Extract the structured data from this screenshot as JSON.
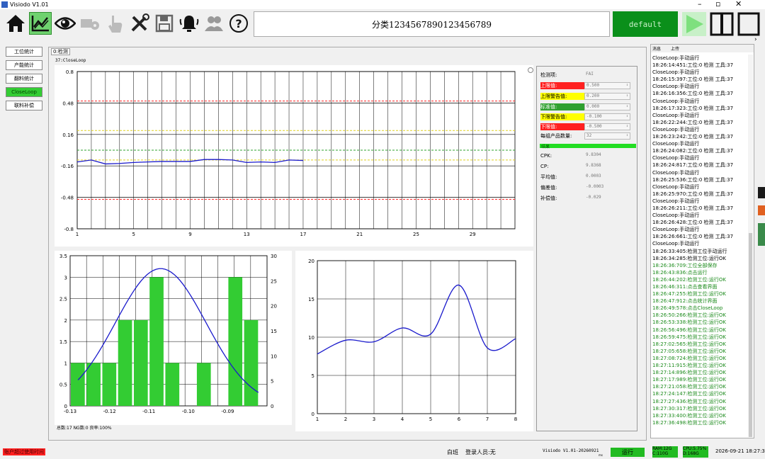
{
  "window": {
    "title": "Visiodo V1.01",
    "min": "–",
    "restore": "▫",
    "close": "✕"
  },
  "toolbar": {
    "category_text": "分类1234567890123456789",
    "default_label": "default",
    "icons": [
      "home-icon",
      "chart-icon",
      "eye-icon",
      "camera-settings-icon",
      "hand-icon",
      "tools-icon",
      "save-icon",
      "alarm-icon",
      "users-icon",
      "help-icon"
    ]
  },
  "nav": [
    "工位统计",
    "产能统计",
    "翻料统计",
    "CloseLoop",
    "联料补偿"
  ],
  "subtab": "0:检测",
  "chart_name": "37:CloseLoop",
  "chart_data": [
    {
      "type": "line",
      "xlim": [
        1,
        32
      ],
      "ylim": [
        -0.8,
        0.8
      ],
      "xticks": [
        1,
        5,
        9,
        13,
        17,
        21,
        25,
        29
      ],
      "yticks": [
        "0.8",
        "0.48",
        "0.16",
        "-0.16",
        "-0.48",
        "-0.8"
      ],
      "ytick_values": [
        0.8,
        0.48,
        0.16,
        -0.16,
        -0.48,
        -0.8
      ],
      "x": [
        1,
        2,
        3,
        4,
        5,
        6,
        7,
        8,
        9,
        10,
        11,
        12,
        13,
        14,
        15,
        16,
        17
      ],
      "values": [
        -0.12,
        -0.1,
        -0.14,
        -0.135,
        -0.125,
        -0.12,
        -0.115,
        -0.115,
        -0.115,
        -0.095,
        -0.095,
        -0.1,
        -0.125,
        -0.12,
        -0.125,
        -0.1,
        -0.105
      ],
      "ref_lines": [
        {
          "y": 0.5,
          "color": "#ff2020"
        },
        {
          "y": 0.2,
          "color": "#e0d020"
        },
        {
          "y": 0,
          "color": "#2fa02f"
        },
        {
          "y": -0.1,
          "color": "#e0d020"
        },
        {
          "y": -0.5,
          "color": "#ff2020"
        }
      ]
    },
    {
      "type": "bar",
      "xlim": [
        -0.13,
        -0.08
      ],
      "ylim": [
        0,
        3.5
      ],
      "y2lim": [
        0,
        30
      ],
      "xticks": [
        "-0.13",
        "-0.12",
        "-0.11",
        "-0.10",
        "-0.09"
      ],
      "xtick_values": [
        -0.13,
        -0.12,
        -0.11,
        -0.1,
        -0.09
      ],
      "yticks": [
        "0",
        "0.5",
        "1",
        "1.5",
        "2",
        "2.5",
        "3",
        "3.5"
      ],
      "y2ticks": [
        "0",
        "5",
        "10",
        "15",
        "20",
        "25",
        "30"
      ],
      "bar_x": [
        -0.13,
        -0.126,
        -0.122,
        -0.118,
        -0.114,
        -0.11,
        -0.106,
        -0.098,
        -0.09,
        -0.086
      ],
      "values": [
        1,
        1,
        1,
        2,
        2,
        3,
        1,
        1,
        3,
        2
      ],
      "curve_peak": -0.107,
      "curve_sigma": 0.0115,
      "curve_max": 3.2
    },
    {
      "type": "line",
      "xlim": [
        1,
        8
      ],
      "ylim": [
        0,
        20
      ],
      "xticks": [
        "1",
        "2",
        "3",
        "4",
        "5",
        "6",
        "7",
        "8"
      ],
      "yticks": [
        "0",
        "5",
        "10",
        "15",
        "20"
      ],
      "x": [
        1,
        2,
        3,
        4,
        5,
        6,
        7,
        8
      ],
      "values": [
        7.8,
        9.6,
        9.4,
        11.2,
        10.4,
        16.8,
        8.6,
        9.8
      ]
    }
  ],
  "hist_summary": "总数:17  NG数:0  良率:100%",
  "side": {
    "item_label": "检测项:",
    "item_value": "FAI",
    "rows": [
      {
        "label": "上限值:",
        "value": "0.500",
        "style": "red"
      },
      {
        "label": "上限警告值:",
        "value": "0.200",
        "style": "yel"
      },
      {
        "label": "标准值:",
        "value": "0.000",
        "style": "grn"
      },
      {
        "label": "下限警告值:",
        "value": "-0.100",
        "style": "yel"
      },
      {
        "label": "下限值:",
        "value": "-0.500",
        "style": "red"
      },
      {
        "label": "每组产品数量:",
        "value": "32",
        "style": ""
      }
    ],
    "result_label": "结果",
    "results": [
      {
        "label": "CPK:",
        "value": "9.8304"
      },
      {
        "label": "CP:",
        "value": "9.8368"
      },
      {
        "label": "平均值:",
        "value": "0.0003"
      },
      {
        "label": "偏差值:",
        "value": "-0.0003"
      },
      {
        "label": "补偿值:",
        "value": "-0.029"
      }
    ]
  },
  "right": {
    "tab1": "消息",
    "tab2": "上传",
    "log": [
      "CloseLoop:手动运行",
      "18:26:14:451:工位:0 检测 工具:37",
      "CloseLoop:手动运行",
      "18:26:15:397:工位:0 检测 工具:37",
      "CloseLoop:手动运行",
      "18:26:16:356:工位:0 检测 工具:37",
      "CloseLoop:手动运行",
      "18:26:17:323:工位:0 检测 工具:37",
      "CloseLoop:手动运行",
      "18:26:22:244:工位:0 检测 工具:37",
      "CloseLoop:手动运行",
      "18:26:23:242:工位:0 检测 工具:37",
      "CloseLoop:手动运行",
      "18:26:24:082:工位:0 检测 工具:37",
      "CloseLoop:手动运行",
      "18:26:24:817:工位:0 检测 工具:37",
      "CloseLoop:手动运行",
      "18:26:25:536:工位:0 检测 工具:37",
      "CloseLoop:手动运行",
      "18:26:25:970:工位:0 检测 工具:37",
      "CloseLoop:手动运行",
      "18:26:26:211:工位:0 检测 工具:37",
      "CloseLoop:手动运行",
      "18:26:26:428:工位:0 检测 工具:37",
      "CloseLoop:手动运行",
      "18:26:26:661:工位:0 检测 工具:37",
      "CloseLoop:手动运行",
      "18:26:33:405:检测工位手动运行",
      "18:26:34:285:检测工位:运行OK",
      "18:26:36:709:工位全部保存",
      "18:26:43:836:点击运行",
      "18:26:44:202:检测工位:运行OK",
      "18:26:46:311:点击查看界面",
      "18:26:47:255:检测工位:运行OK",
      "18:26:47:912:点击统计界面",
      "18:26:49:578:点击CloseLoop",
      "18:26:50:266:检测工位:运行OK",
      "18:26:53:338:检测工位:运行OK",
      "18:26:56:496:检测工位:运行OK",
      "18:26:59:475:检测工位:运行OK",
      "18:27:02:565:检测工位:运行OK",
      "18:27:05:658:检测工位:运行OK",
      "18:27:08:724:检测工位:运行OK",
      "18:27:11:915:检测工位:运行OK",
      "18:27:14:896:检测工位:运行OK",
      "18:27:17:989:检测工位:运行OK",
      "18:27:21:058:检测工位:运行OK",
      "18:27:24:147:检测工位:运行OK",
      "18:27:27:436:检测工位:运行OK",
      "18:27:30:317:检测工位:运行OK",
      "18:27:33:400:检测工位:运行OK",
      "18:27:36:498:检测工位:运行OK"
    ],
    "green_from": 29
  },
  "status": {
    "left": "账户超过使用时间",
    "shift": "白班",
    "user": "登录人员:无",
    "version": "Visiodo V1.01-20260921",
    "ms": "ms",
    "run": "运行",
    "ram": "RAM:12G\nC:110G",
    "cpu": "CPU:5.75%\nD:168G",
    "datetime": "2026-09-21 18:27:32"
  },
  "colors": {
    "accent": "#33cc33",
    "toolbar_green": "#0a8f1a",
    "plot_line": "#1a1acc",
    "bar": "#33cc33",
    "red": "#ff2020"
  }
}
